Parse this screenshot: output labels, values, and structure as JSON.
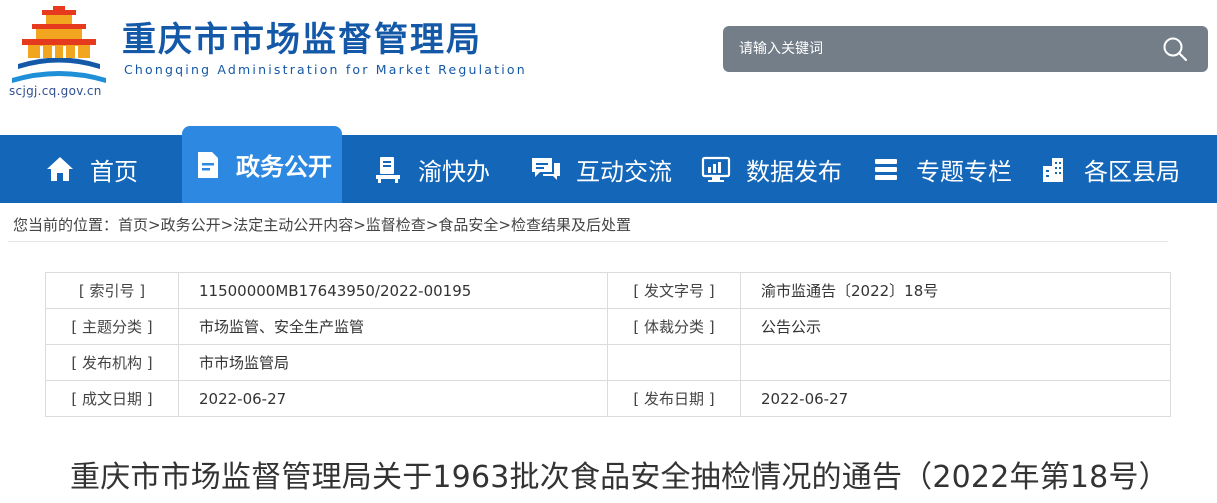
{
  "header": {
    "site_title": "重庆市市场监督管理局",
    "site_subtitle": "Chongqing  Administration for Market Regulation",
    "site_url": "scjgj.cq.gov.cn",
    "search_placeholder": "请输入关键词",
    "colors": {
      "brand_blue": "#1458a8",
      "search_bg": "#747e89"
    }
  },
  "nav": {
    "items": [
      {
        "label": "首页",
        "icon": "home-icon",
        "active": false
      },
      {
        "label": "政务公开",
        "icon": "document-icon",
        "active": true
      },
      {
        "label": "渝快办",
        "icon": "desk-icon",
        "active": false
      },
      {
        "label": "互动交流",
        "icon": "chat-icon",
        "active": false
      },
      {
        "label": "数据发布",
        "icon": "chart-monitor-icon",
        "active": false
      },
      {
        "label": "专题专栏",
        "icon": "stack-icon",
        "active": false
      },
      {
        "label": "各区县局",
        "icon": "buildings-icon",
        "active": false
      }
    ],
    "colors": {
      "bar": "#1366b8",
      "active": "#2c88e0"
    }
  },
  "breadcrumb": {
    "prefix": "您当前的位置：",
    "items": [
      "首页",
      "政务公开",
      "法定主动公开内容",
      "监督检查",
      "食品安全",
      "检查结果及后处置"
    ],
    "separator": ">"
  },
  "info": {
    "index_label": "[ 索引号 ]",
    "index_value": "11500000MB17643950/2022-00195",
    "doc_no_label": "[ 发文字号 ]",
    "doc_no_value": "渝市监通告〔2022〕18号",
    "topic_label": "[ 主题分类 ]",
    "topic_value": "市场监管、安全生产监管",
    "genre_label": "[ 体裁分类 ]",
    "genre_value": "公告公示",
    "issuer_label": "[ 发布机构 ]",
    "issuer_value": "市市场监管局",
    "created_label": "[ 成文日期 ]",
    "created_value": "2022-06-27",
    "published_label": "[ 发布日期 ]",
    "published_value": "2022-06-27"
  },
  "article": {
    "title": "重庆市市场监督管理局关于1963批次食品安全抽检情况的通告（2022年第18号）"
  }
}
